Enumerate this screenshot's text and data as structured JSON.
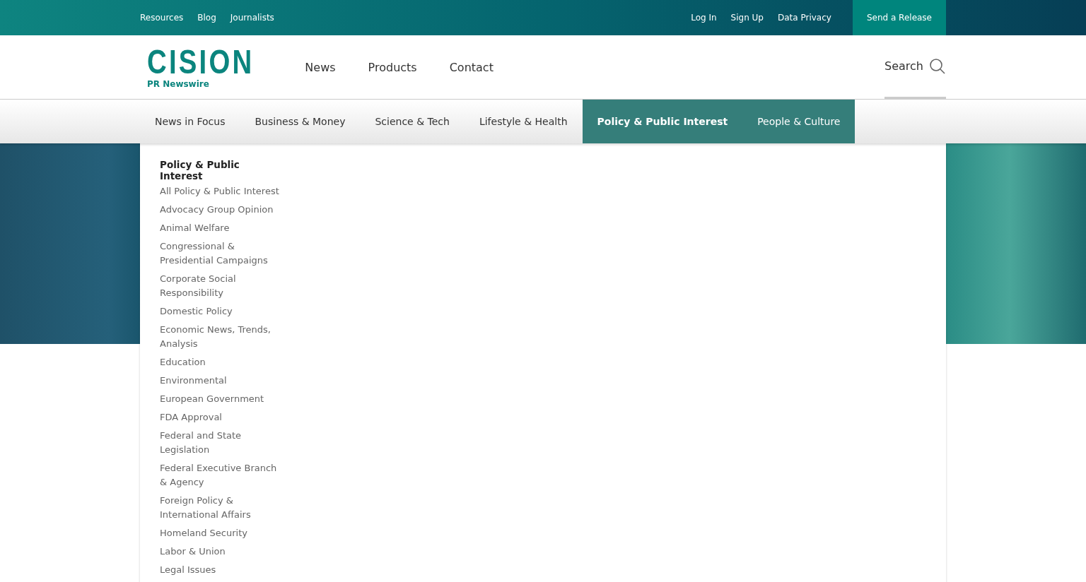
{
  "top_bar": {
    "left_links": [
      "Resources",
      "Blog",
      "Journalists"
    ],
    "right_links": [
      "Log In",
      "Sign Up",
      "Data Privacy"
    ],
    "cta": "Send a Release"
  },
  "header": {
    "logo": {
      "wordmark": "CISION",
      "tagline": "PR Newswire"
    },
    "nav": [
      "News",
      "Products",
      "Contact"
    ],
    "search": "Search"
  },
  "categories": [
    {
      "label": "News in Focus",
      "selected": false,
      "highlighted": false
    },
    {
      "label": "Business & Money",
      "selected": false,
      "highlighted": false
    },
    {
      "label": "Science & Tech",
      "selected": false,
      "highlighted": false
    },
    {
      "label": "Lifestyle & Health",
      "selected": false,
      "highlighted": false
    },
    {
      "label": "Policy & Public Interest",
      "selected": true,
      "highlighted": true
    },
    {
      "label": "People & Culture",
      "selected": false,
      "highlighted": true
    }
  ],
  "dropdown": {
    "heading": "Policy & Public Interest",
    "items": [
      "All Policy & Public Interest",
      "Advocacy Group Opinion",
      "Animal Welfare",
      "Congressional & Presidential Campaigns",
      "Corporate Social Responsibility",
      "Domestic Policy",
      "Economic News, Trends, Analysis",
      "Education",
      "Environmental",
      "European Government",
      "FDA Approval",
      "Federal and State Legislation",
      "Federal Executive Branch & Agency",
      "Foreign Policy & International Affairs",
      "Homeland Security",
      "Labor & Union",
      "Legal Issues"
    ]
  }
}
